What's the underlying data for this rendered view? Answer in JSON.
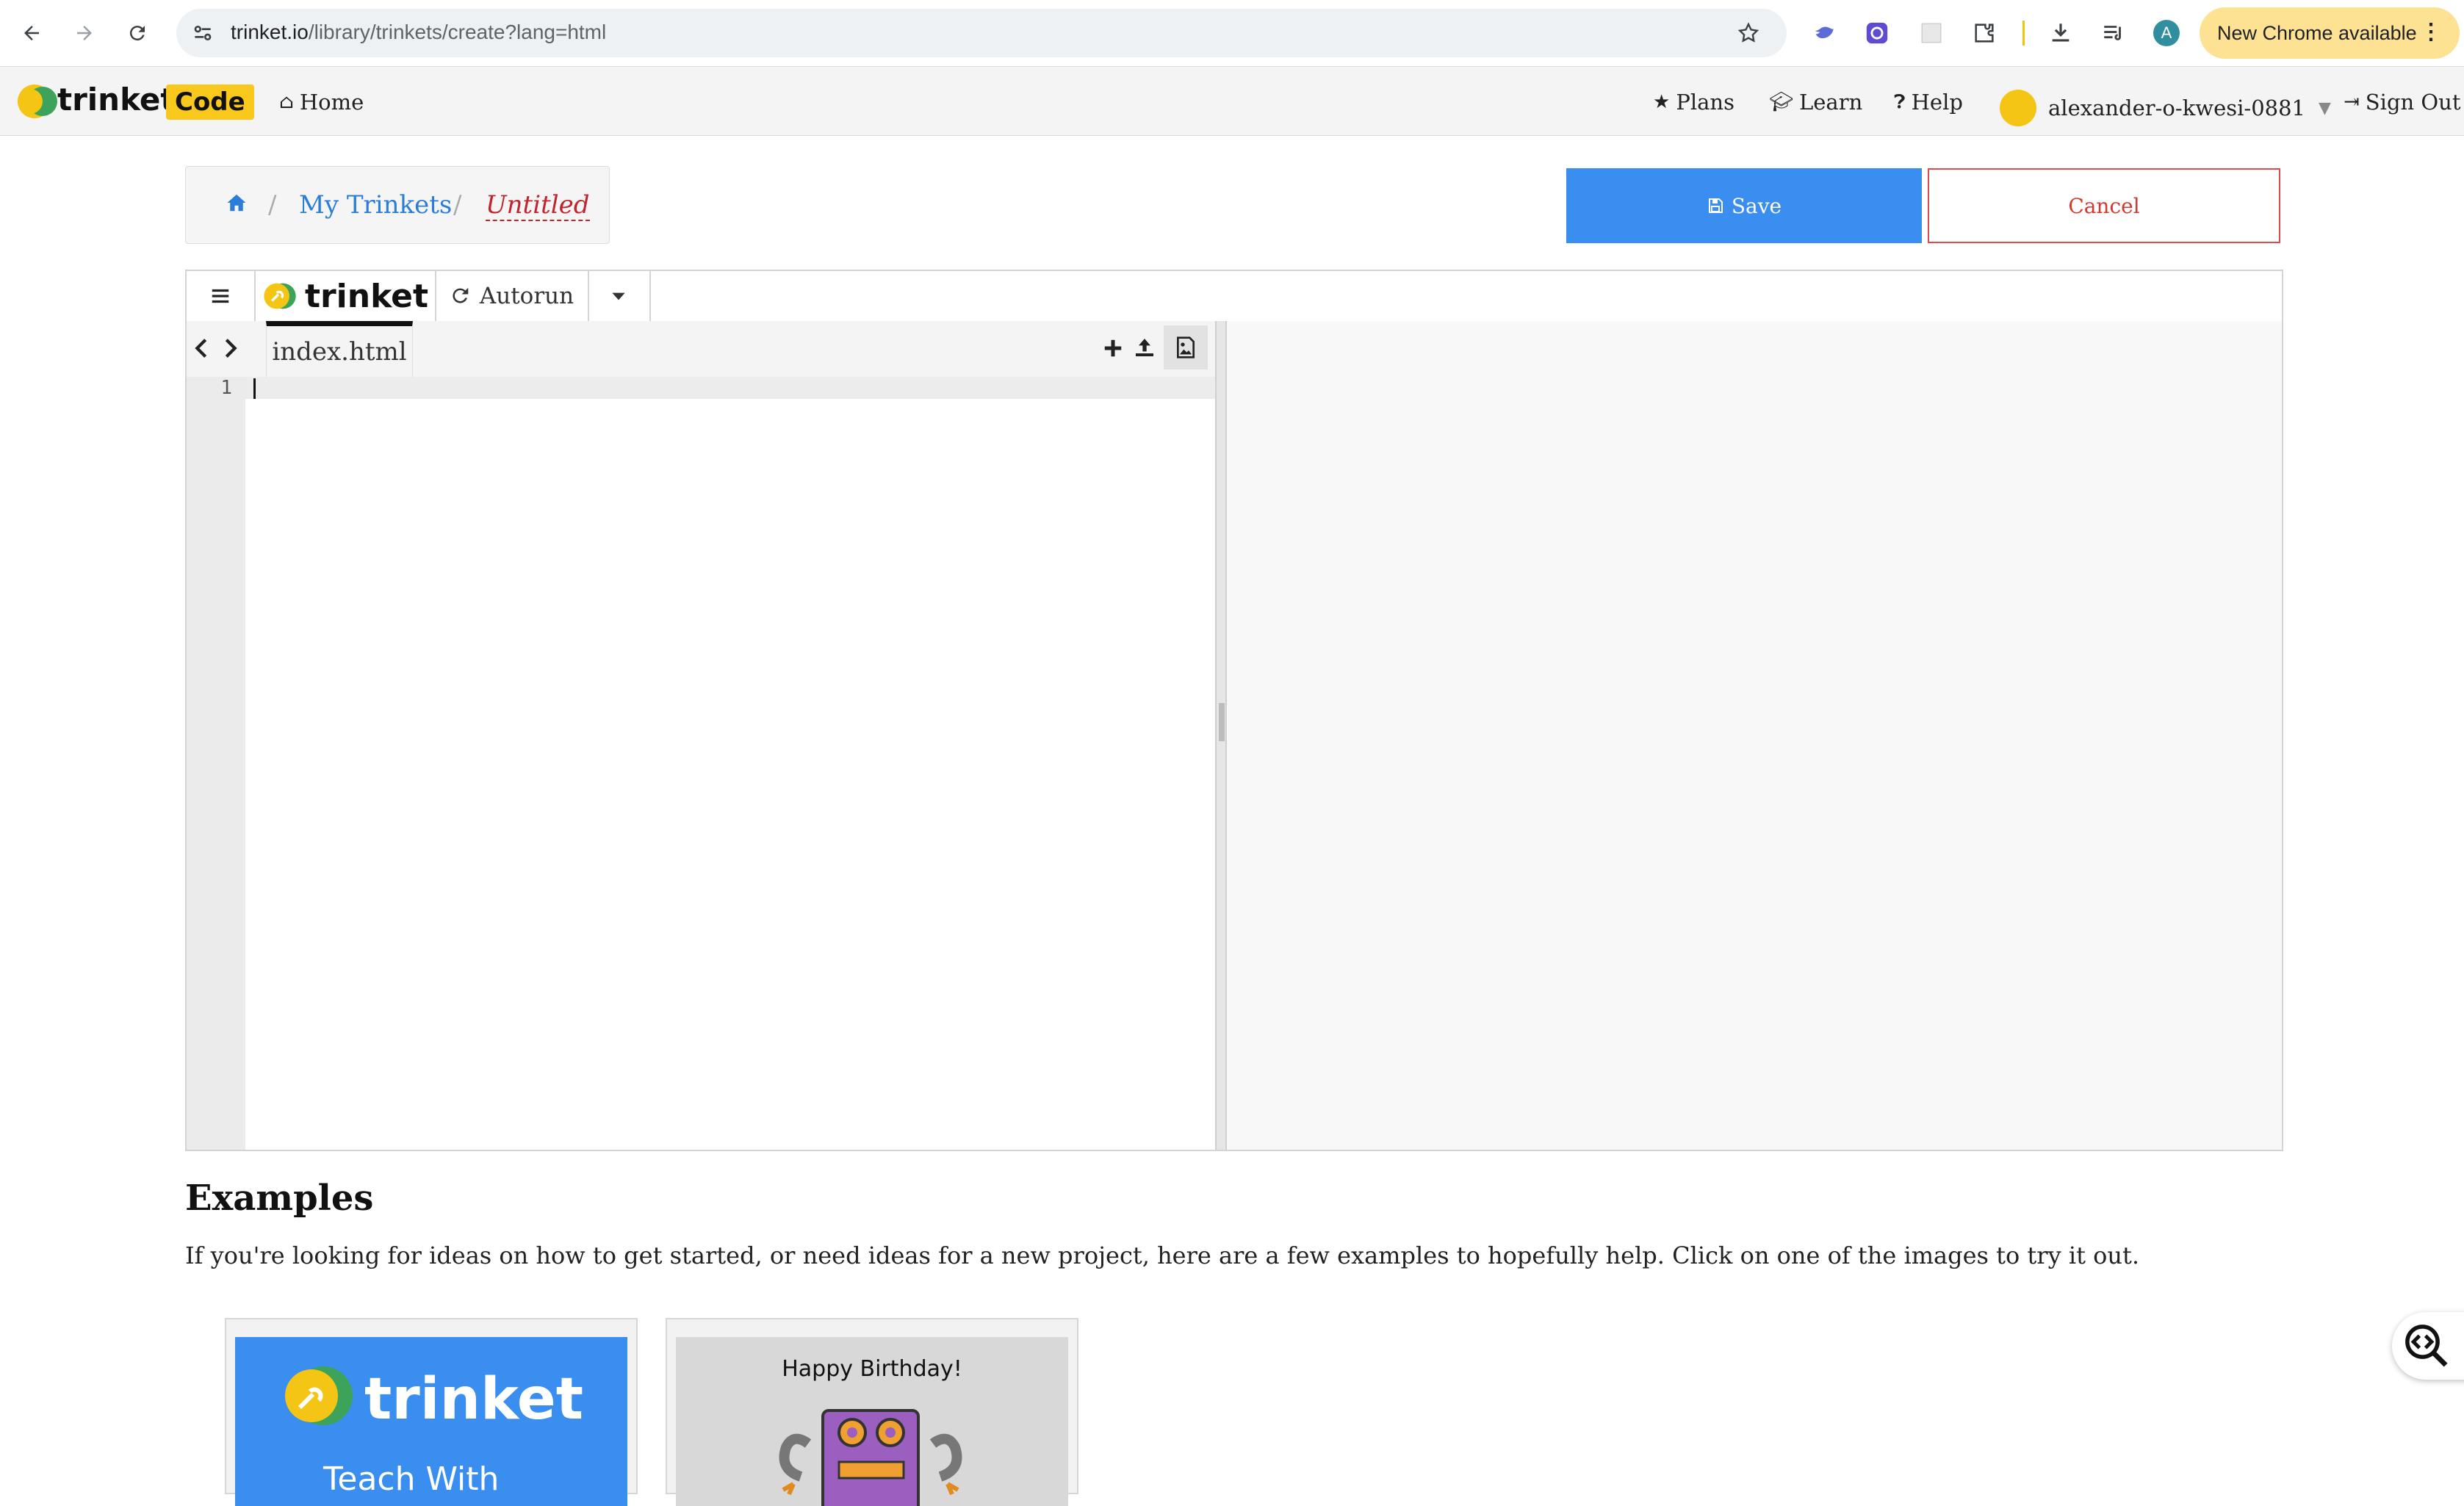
{
  "browser": {
    "url_host": "trinket.io",
    "url_path": "/library/trinkets/create?lang=html",
    "profile_initial": "A",
    "update_label": "New Chrome available"
  },
  "header": {
    "brand": "trinket",
    "badge": "Code",
    "home": "Home",
    "plans": "Plans",
    "learn": "Learn",
    "help": "Help",
    "user": "alexander-o-kwesi-0881",
    "sign_out": "Sign Out"
  },
  "breadcrumb": {
    "sep": "/",
    "my_trinkets": "My Trinkets",
    "title": "Untitled"
  },
  "actions": {
    "save": "Save",
    "cancel": "Cancel"
  },
  "editor": {
    "brand": "trinket",
    "autorun": "Autorun",
    "file_tab": "index.html",
    "line_number": "1"
  },
  "examples": {
    "title": "Examples",
    "description": "If you're looking for ideas on how to get started, or need ideas for a new project, here are a few examples to hopefully help. Click on one of the images to try it out.",
    "cards": [
      {
        "title": "trinket",
        "subtitle": "Teach With"
      },
      {
        "title": "Happy Birthday!"
      }
    ]
  },
  "colors": {
    "accent_blue": "#3a8ef0",
    "cancel_red": "#e24b4b",
    "brand_yellow": "#f8c81c",
    "title_red": "#c0252f"
  }
}
